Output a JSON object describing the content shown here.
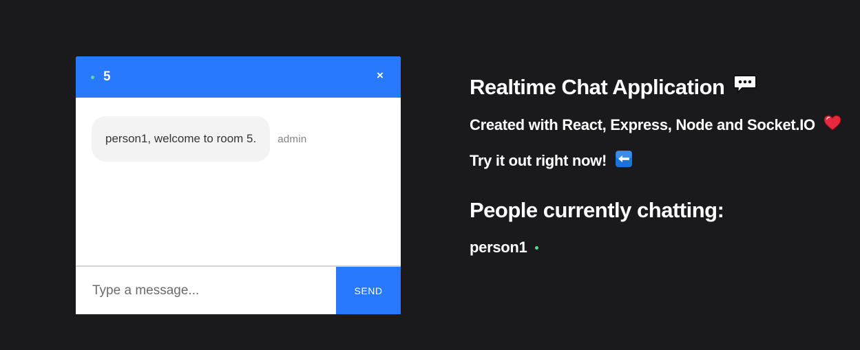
{
  "colors": {
    "page_background": "#1a1a1d",
    "accent": "#2979ff",
    "online": "#5cd89d",
    "heart": "#e8283c"
  },
  "chat": {
    "room_name": "5",
    "close_symbol": "×",
    "messages": [
      {
        "text": "person1, welcome to room 5.",
        "sender": "admin"
      }
    ],
    "input": {
      "value": "",
      "placeholder": "Type a message..."
    },
    "send_label": "SEND"
  },
  "info": {
    "title": "Realtime Chat Application",
    "title_icon": "speech-balloon-icon",
    "created_with": "Created with React, Express, Node and Socket.IO",
    "created_icon": "heart-icon",
    "try_it": "Try it out right now!",
    "try_icon": "left-arrow-icon",
    "people_title": "People currently chatting:",
    "users": [
      "person1"
    ]
  }
}
